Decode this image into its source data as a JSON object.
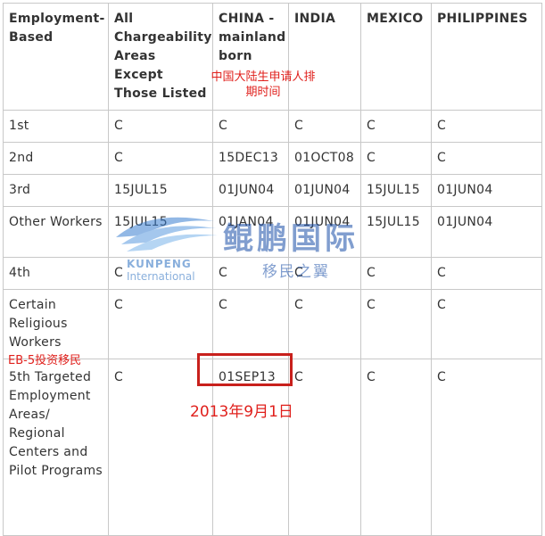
{
  "table": {
    "header": [
      "Employment-Based",
      "All Chargeability Areas Except Those Listed",
      "CHINA - mainland born",
      "INDIA",
      "MEXICO",
      "PHILIPPINES"
    ],
    "rows": [
      [
        "1st",
        "C",
        "C",
        "C",
        "C",
        "C"
      ],
      [
        "2nd",
        "C",
        "15DEC13",
        "01OCT08",
        "C",
        "C"
      ],
      [
        "3rd",
        "15JUL15",
        "01JUN04",
        "01JUN04",
        "15JUL15",
        "01JUN04"
      ],
      [
        "Other Workers",
        "15JUL15",
        "01JAN04",
        "01JUN04",
        "15JUL15",
        "01JUN04"
      ],
      [
        "4th",
        "C",
        "C",
        "C",
        "C",
        "C"
      ],
      [
        "Certain Religious Workers",
        "C",
        "C",
        "C",
        "C",
        "C"
      ],
      [
        "5th Targeted Employment Areas/ Regional Centers and Pilot Programs",
        "C",
        "01SEP13",
        "C",
        "C",
        "C"
      ]
    ]
  },
  "annotations": {
    "china_note": "中国大陆生申请人排期时间",
    "eb5_note": "EB-5投资移民",
    "date_note": "2013年9月1日"
  },
  "watermark": {
    "en_line1": "KUNPENG",
    "en_line2": "International",
    "cn_line1": "鲲鹏国际",
    "cn_line2": "移民之翼"
  },
  "colors": {
    "annotation_red": "#e0201c",
    "box_red": "#c8201c",
    "watermark_blue": "#1b4fa8",
    "border": "#c8c8c8"
  }
}
